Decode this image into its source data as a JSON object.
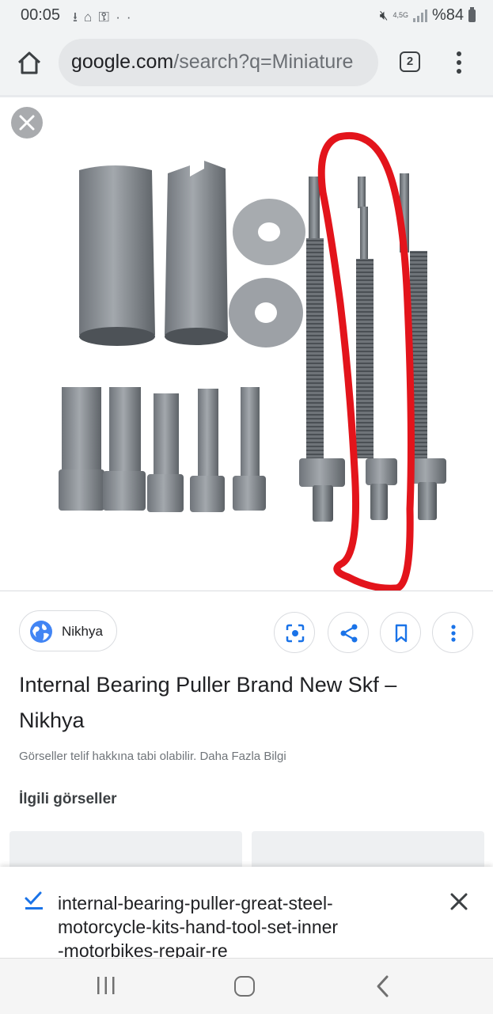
{
  "status_bar": {
    "time": "00:05",
    "left_icons": [
      "download-icon",
      "hotspot-icon",
      "key-icon",
      "more-dots-icon"
    ],
    "network_top": "4,5G",
    "battery_text": "%84"
  },
  "browser": {
    "url_host": "google.com",
    "url_rest": "/search?q=Miniature",
    "tab_count": "2"
  },
  "image_viewer": {
    "source_name": "Nikhya",
    "title": "Internal Bearing Puller Brand New Skf – Nikhya",
    "copyright": "Görseller telif hakkına tabi olabilir. Daha Fazla Bilgi",
    "related_heading": "İlgili görseller"
  },
  "banner": {
    "text": "internal-bearing-puller-great-steel-motorcycle-kits-hand-tool-set-inner-motorbikes-repair-re"
  },
  "colors": {
    "chrome_bg": "#f1f3f4",
    "accent_blue": "#1a73e8",
    "annotation_red": "#e3141b",
    "metal": "#8f9499"
  }
}
